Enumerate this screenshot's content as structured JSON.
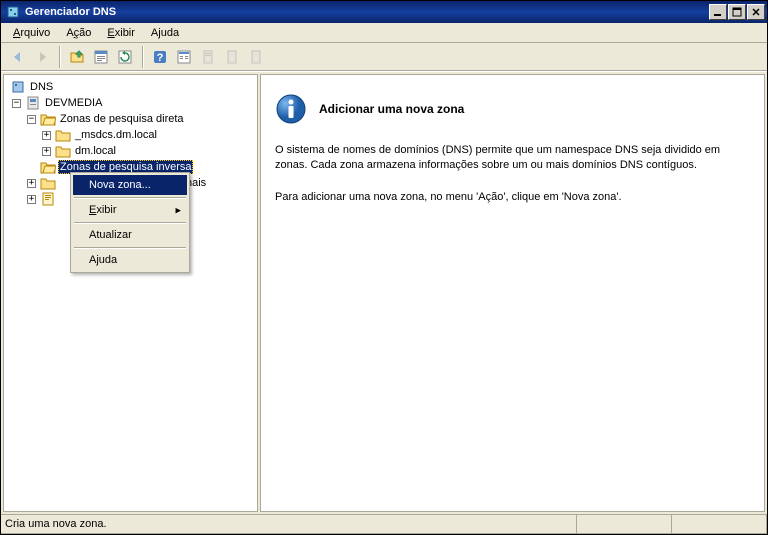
{
  "window": {
    "title": "Gerenciador DNS"
  },
  "menu": {
    "file": "Arquivo",
    "action": "Ação",
    "view": "Exibir",
    "help": "Ajuda"
  },
  "tree": {
    "root": "DNS",
    "server": "DEVMEDIA",
    "fwd_zones": "Zonas de pesquisa direta",
    "msdcs": "_msdcs.dm.local",
    "dmlocal": "dm.local",
    "rev_zones": "Zonas de pesquisa inversa",
    "cond_fwd": "icionais"
  },
  "context_menu": {
    "new_zone": "Nova zona...",
    "view": "Exibir",
    "refresh": "Atualizar",
    "help": "Ajuda"
  },
  "detail": {
    "heading": "Adicionar uma nova zona",
    "p1": "O sistema de nomes de domínios (DNS) permite que um namespace DNS seja dividido em zonas. Cada zona armazena informações sobre um ou mais domínios DNS contíguos.",
    "p2": "Para adicionar uma nova zona, no menu 'Ação', clique em 'Nova zona'."
  },
  "status": {
    "text": "Cria uma nova zona."
  }
}
